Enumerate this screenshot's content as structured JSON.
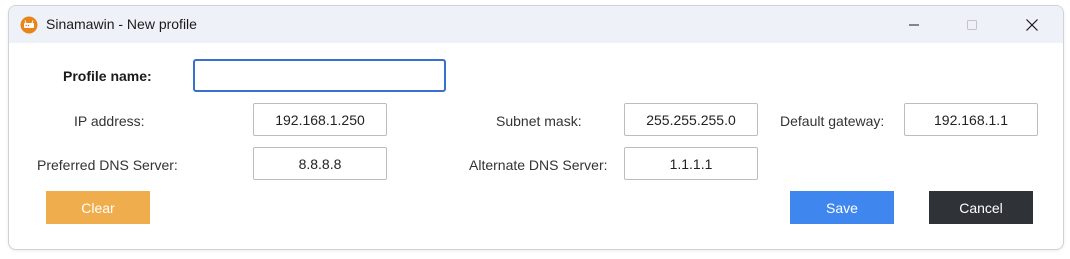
{
  "window": {
    "title": "Sinamawin - New profile"
  },
  "icons": {
    "app": "router-app-icon",
    "minimize": "minimize-icon",
    "maximize": "maximize-icon",
    "close": "close-icon"
  },
  "form": {
    "profile_name_label": "Profile name:",
    "profile_name_value": "",
    "ip_label": "IP address:",
    "ip_value": "192.168.1.250",
    "subnet_label": "Subnet mask:",
    "subnet_value": "255.255.255.0",
    "gateway_label": "Default gateway:",
    "gateway_value": "192.168.1.1",
    "preferred_dns_label": "Preferred DNS Server:",
    "preferred_dns_value": "8.8.8.8",
    "alternate_dns_label": "Alternate DNS Server:",
    "alternate_dns_value": "1.1.1.1"
  },
  "buttons": {
    "clear": "Clear",
    "save": "Save",
    "cancel": "Cancel"
  },
  "colors": {
    "clear": "#f0ad4e",
    "save": "#3f87ee",
    "cancel": "#2f3338",
    "focus": "#3a6fd0"
  }
}
